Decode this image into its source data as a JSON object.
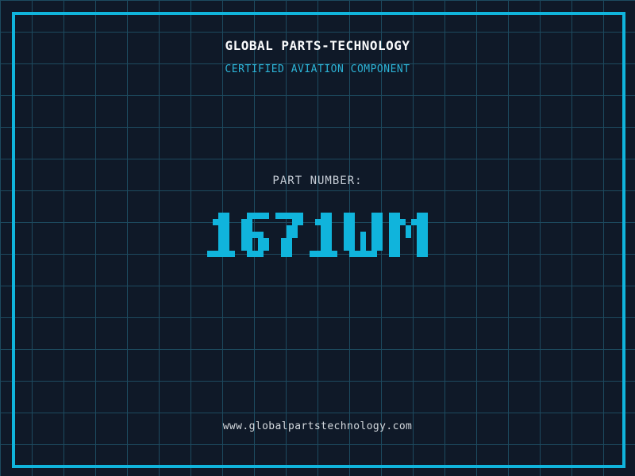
{
  "header": {
    "title": "GLOBAL PARTS-TECHNOLOGY",
    "subtitle": "CERTIFIED AVIATION COMPONENT"
  },
  "part": {
    "label": "PART NUMBER:",
    "number": "1671WM"
  },
  "footer": {
    "url": "www.globalpartstechnology.com"
  },
  "theme": {
    "background": "#0f1928",
    "grid_line": "#1d4a5f",
    "frame": "#10b4dc",
    "accent": "#10b4dc",
    "title_color": "#fafbfc",
    "subtitle_color": "#2cb3d6",
    "muted_color": "#c4cbd4",
    "footer_color": "#d4d9de"
  }
}
